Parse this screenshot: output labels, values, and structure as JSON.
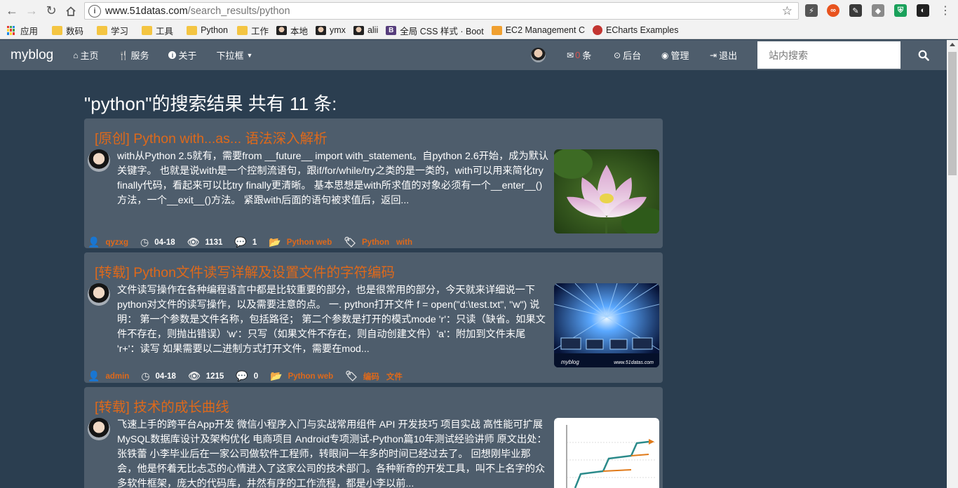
{
  "browser": {
    "url_host": "www.51datas.com",
    "url_path": "/search_results/python",
    "bookmarks": [
      {
        "label": "应用",
        "icon": "apps-grid-icon"
      },
      {
        "label": "数码",
        "icon": "folder-icon"
      },
      {
        "label": "学习",
        "icon": "folder-icon"
      },
      {
        "label": "工具",
        "icon": "folder-icon"
      },
      {
        "label": "Python",
        "icon": "folder-icon"
      },
      {
        "label": "工作",
        "icon": "folder-icon"
      },
      {
        "label": "本地",
        "icon": "avatar-icon"
      },
      {
        "label": "ymx",
        "icon": "avatar-icon"
      },
      {
        "label": "alii",
        "icon": "avatar-icon"
      },
      {
        "label": "全局 CSS 样式 · Boot",
        "icon": "bootstrap-icon"
      },
      {
        "label": "EC2 Management C",
        "icon": "aws-box-icon"
      },
      {
        "label": "ECharts Examples",
        "icon": "echarts-icon"
      }
    ]
  },
  "navbar": {
    "brand": "myblog",
    "items": [
      {
        "label": "主页",
        "icon": "home-icon"
      },
      {
        "label": "服务",
        "icon": "cutlery-icon"
      },
      {
        "label": "关于",
        "icon": "info-icon"
      },
      {
        "label": "下拉框",
        "icon": "caret-down-icon"
      }
    ],
    "messages_count": "0",
    "messages_unit": "条",
    "backend_label": "后台",
    "manage_label": "管理",
    "logout_label": "退出",
    "search_placeholder": "站内搜索"
  },
  "results": {
    "title": "\"python\"的搜索结果 共有 11 条:",
    "items": [
      {
        "title": "[原创]  Python with...as... 语法深入解析",
        "summary": "with从Python 2.5就有，需要from __future__ import with_statement。自python 2.6开始，成为默认关键字。 也就是说with是一个控制流语句，跟if/for/while/try之类的是一类的，with可以用来简化try finally代码，看起来可以比try finally更清晰。 基本思想是with所求值的对象必须有一个__enter__()方法，一个__exit__()方法。 紧跟with后面的语句被求值后，返回...",
        "author": "qyzxg",
        "date": "04-18",
        "views": "1131",
        "comments": "1",
        "category": "Python web",
        "tags": [
          "Python",
          "with"
        ],
        "thumb": "lotus"
      },
      {
        "title": "[转载]  Python文件读写详解及设置文件的字符编码",
        "summary": "文件读写操作在各种编程语言中都是比较重要的部分，也是很常用的部分，今天就来详细说一下python对文件的读写操作，以及需要注意的点。 一. python打开文件 f = open(\"d:\\test.txt\", \"w\") 说明： 第一个参数是文件名称，包括路径； 第二个参数是打开的模式mode 'r'：只读（缺省。如果文件不存在，则抛出错误）'w'：只写（如果文件不存在，则自动创建文件）'a'：附加到文件末尾 'r+'：读写 如果需要以二进制方式打开文件，需要在mod...",
        "author": "admin",
        "date": "04-18",
        "views": "1215",
        "comments": "0",
        "category": "Python web",
        "tags": [
          "编码",
          "文件"
        ],
        "thumb": "matrix",
        "thumb_caption_left": "myblog",
        "thumb_caption_right": "www.51datas.com"
      },
      {
        "title": "[转载] 技术的成长曲线",
        "summary": "  飞速上手的跨平台App开发 微信小程序入门与实战常用组件 API 开发技巧 项目实战 高性能可扩展MySQL数据库设计及架构优化 电商项目 Android专项测试-Python篇10年测试经验讲师  原文出处： 张铁蕾   小李毕业后在一家公司做软件工程师，转眼间一年多的时间已经过去了。 回想刚毕业那会，他是怀着无比忐忑的心情进入了这家公司的技术部门。各种新奇的开发工具，叫不上名字的众多软件框架，庞大的代码库，井然有序的工作流程，都是小李以前...",
        "thumb": "chart"
      }
    ]
  },
  "colors": {
    "accent": "#df691a",
    "navbar": "#4e5d6c",
    "background": "#2b3e50"
  }
}
